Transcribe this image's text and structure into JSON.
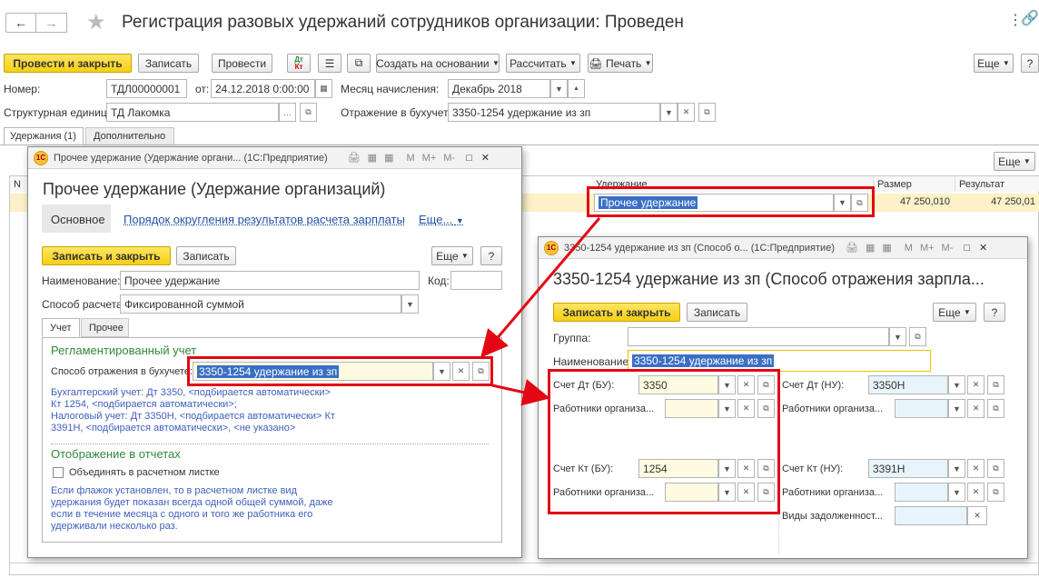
{
  "main": {
    "title": "Регистрация разовых удержаний сотрудников организации: Проведен",
    "toolbar": {
      "post_close": "Провести и закрыть",
      "write": "Записать",
      "post": "Провести",
      "dtkt_top": "Дт",
      "dtkt_bottom": "Кт",
      "create_based": "Создать на основании",
      "calculate": "Рассчитать",
      "print": "Печать",
      "more": "Еще",
      "help": "?"
    },
    "number_label": "Номер:",
    "number": "ТДЛ00000001",
    "date_label": "от:",
    "date": "24.12.2018  0:00:00",
    "month_label": "Месяц начисления:",
    "month": "Декабрь 2018",
    "unit_label": "Структурная единица:",
    "unit": "ТД Лакомка",
    "reflection_label": "Отражение в бухучете:",
    "reflection": "3350-1254 удержание из зп",
    "tabs": [
      "Удержания (1)",
      "Дополнительно"
    ],
    "table": {
      "more": "Еще",
      "col_n": "N",
      "col_deduction": "Удержание",
      "col_size": "Размер",
      "col_result": "Результат",
      "row": {
        "deduction": "Прочее удержание",
        "size": "47 250,010",
        "result": "47 250,01"
      }
    }
  },
  "win1": {
    "titlebar": "Прочее удержание (Удержание органи...  (1С:Предприятие)",
    "title": "Прочее удержание (Удержание организаций)",
    "nav": {
      "main": "Основное",
      "rounding": "Порядок округления результатов расчета зарплаты",
      "more": "Еще..."
    },
    "toolbar": {
      "save_close": "Записать и закрыть",
      "save": "Записать",
      "more": "Еще",
      "help": "?"
    },
    "name_label": "Наименование:",
    "name": "Прочее удержание",
    "code_label": "Код:",
    "code": "",
    "calc_label": "Способ расчета:",
    "calc": "Фиксированной суммой",
    "tabs": [
      "Учет",
      "Прочее"
    ],
    "section1": "Регламентированный учет",
    "method_label": "Способ отражения в бухучете:",
    "method": "3350-1254 удержание из зп",
    "note1": "Бухгалтерский учет: Дт 3350, <подбирается автоматически>",
    "note2": "Кт 1254, <подбирается автоматически>;",
    "note3": "Налоговый учет: Дт 3350Н, <подбирается автоматически> Кт",
    "note4": "3391Н, <подбирается автоматически>, <не указано>",
    "section2": "Отображение в отчетах",
    "checkbox": "Объединять в расчетном листке",
    "hint1": "Если флажок установлен, то в расчетном листке вид",
    "hint2": "удержания будет показан всегда одной общей суммой, даже",
    "hint3": "если в течение месяца с одного и того же работника его",
    "hint4": "удерживали несколько раз."
  },
  "win2": {
    "titlebar": "3350-1254 удержание из зп (Способ о...  (1С:Предприятие)",
    "title": "3350-1254 удержание из зп (Способ отражения зарпла...",
    "toolbar": {
      "save_close": "Записать и закрыть",
      "save": "Записать",
      "more": "Еще",
      "help": "?"
    },
    "group_label": "Группа:",
    "group": "",
    "name_label": "Наименование:",
    "name": "3350-1254 удержание из зп",
    "dt_bu_label": "Счет Дт (БУ):",
    "dt_bu": "3350",
    "dt_nu_label": "Счет Дт (НУ):",
    "dt_nu": "3350Н",
    "workers_label": "Работники организа...",
    "kt_bu_label": "Счет Кт (БУ):",
    "kt_bu": "1254",
    "kt_nu_label": "Счет Кт (НУ):",
    "kt_nu": "3391Н",
    "debt_label": "Виды задолженност..."
  },
  "colors": {
    "accent_yellow": "#f5cf14",
    "highlight_red": "#e30613",
    "link_blue": "#2453a8",
    "section_green": "#2f8a3a"
  }
}
